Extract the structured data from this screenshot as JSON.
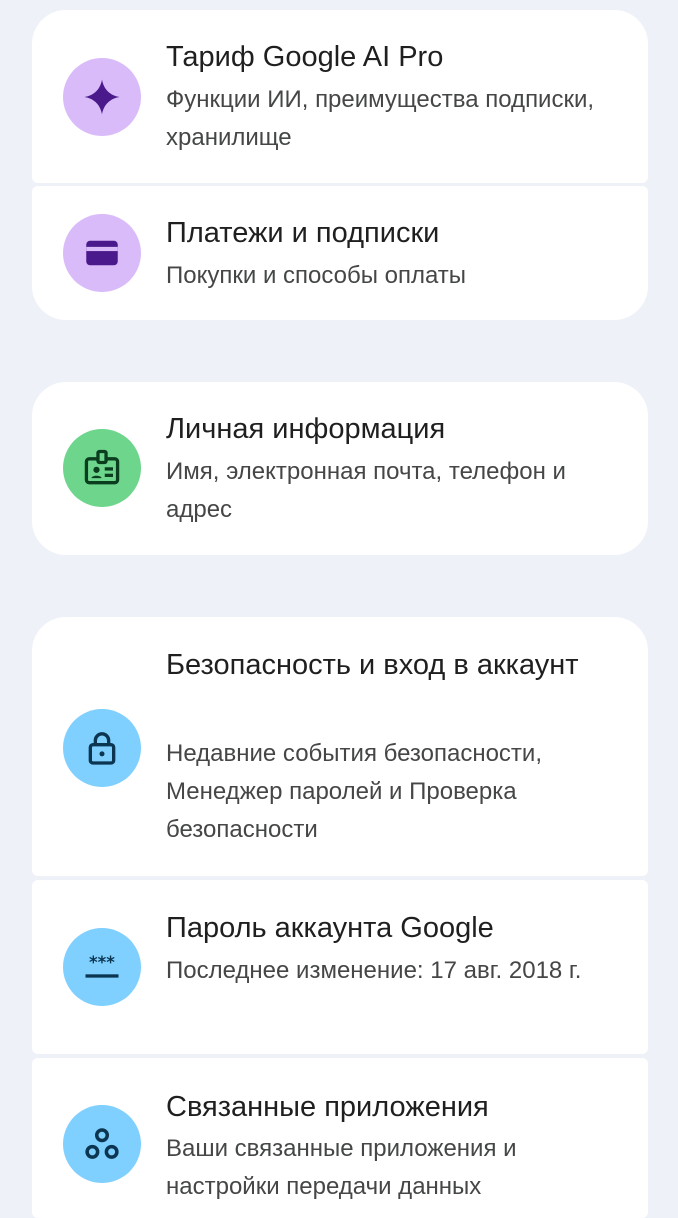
{
  "items": [
    {
      "title": "Тариф Google AI Pro",
      "subtitle": "Функции ИИ, преимущества подписки, хранилище",
      "icon": "sparkle-icon",
      "icon_bg": "#d9bbf9",
      "icon_color": "#4a1a8c"
    },
    {
      "title": "Платежи и подписки",
      "subtitle": "Покупки и способы оплаты",
      "icon": "wallet-icon",
      "icon_bg": "#d9bbf9",
      "icon_color": "#4a1a8c"
    },
    {
      "title": "Личная информация",
      "subtitle": "Имя, электронная почта, телефон и адрес",
      "icon": "id-badge-icon",
      "icon_bg": "#6dd58c",
      "icon_color": "#0b3d1f"
    },
    {
      "title": "Безопасность и вход в аккаунт",
      "subtitle": "Недавние события безопасности, Менеджер паролей и Проверка безопасности",
      "icon": "lock-icon",
      "icon_bg": "#7fcfff",
      "icon_color": "#0b3550"
    },
    {
      "title": "Пароль аккаунта Google",
      "subtitle": "Последнее изменение: 17 авг. 2018 г.",
      "icon": "password-icon",
      "icon_bg": "#7fcfff",
      "icon_color": "#0b3550"
    },
    {
      "title": "Связанные приложения",
      "subtitle": "Ваши связанные приложения и настройки передачи данных",
      "icon": "connected-apps-icon",
      "icon_bg": "#7fcfff",
      "icon_color": "#0b3550"
    }
  ]
}
